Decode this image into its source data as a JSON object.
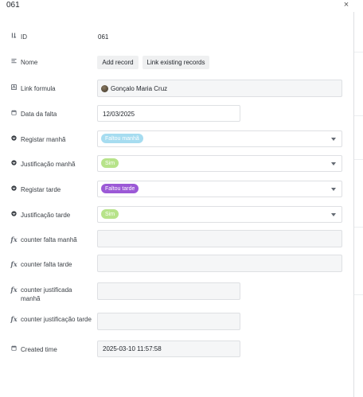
{
  "header": {
    "title": "061",
    "close_glyph": "×"
  },
  "fields": {
    "id": {
      "label": "ID",
      "value": "061",
      "icon": "id-icon"
    },
    "nome": {
      "label": "Nome",
      "icon": "list-icon",
      "buttons": [
        "Add record",
        "Link existing records"
      ]
    },
    "link_formula": {
      "label": "Link formula",
      "icon": "formula-link-icon",
      "user": "Gonçalo Maria Cruz"
    },
    "data_falta": {
      "label": "Data da falta",
      "icon": "calendar-icon",
      "value": "12/03/2025"
    },
    "registar_manha": {
      "label": "Registar manhã",
      "icon": "dropdown-circle-icon",
      "value": "Faltou manhã",
      "chip_color": "#a6dcf0"
    },
    "justificacao_manha": {
      "label": "Justificação manhã",
      "icon": "dropdown-circle-icon",
      "value": "Sim",
      "chip_color": "#b7e38a"
    },
    "registar_tarde": {
      "label": "Registar tarde",
      "icon": "dropdown-circle-icon",
      "value": "Faltou tarde",
      "chip_color": "#9b59d6"
    },
    "justificacao_tarde": {
      "label": "Justificação tarde",
      "icon": "dropdown-circle-icon",
      "value": "Sim",
      "chip_color": "#b7e38a"
    },
    "counter_falta_manha": {
      "label": "counter falta manhã",
      "icon": "fx-icon"
    },
    "counter_falta_tarde": {
      "label": "counter falta tarde",
      "icon": "fx-icon"
    },
    "counter_justificada_manha": {
      "label": "counter justificada manhã",
      "icon": "fx-icon"
    },
    "counter_justificacao_tarde": {
      "label": "counter justificação tarde",
      "icon": "fx-icon"
    },
    "created_time": {
      "label": "Created time",
      "icon": "calendar-icon",
      "value": "2025-03-10 11:57:58"
    }
  }
}
